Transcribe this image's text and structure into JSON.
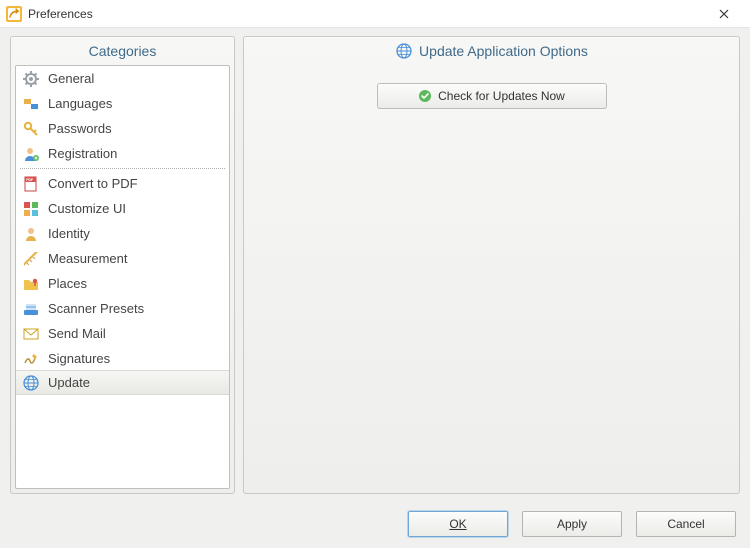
{
  "window": {
    "title": "Preferences"
  },
  "sidebar": {
    "header": "Categories",
    "group1": [
      {
        "label": "General"
      },
      {
        "label": "Languages"
      },
      {
        "label": "Passwords"
      },
      {
        "label": "Registration"
      }
    ],
    "group2": [
      {
        "label": "Convert to PDF"
      },
      {
        "label": "Customize UI"
      },
      {
        "label": "Identity"
      },
      {
        "label": "Measurement"
      },
      {
        "label": "Places"
      },
      {
        "label": "Scanner Presets"
      },
      {
        "label": "Send Mail"
      },
      {
        "label": "Signatures"
      },
      {
        "label": "Update",
        "selected": true
      }
    ]
  },
  "main": {
    "header": "Update Application Options",
    "check_button": "Check for Updates Now"
  },
  "footer": {
    "ok": "OK",
    "apply": "Apply",
    "cancel": "Cancel"
  }
}
